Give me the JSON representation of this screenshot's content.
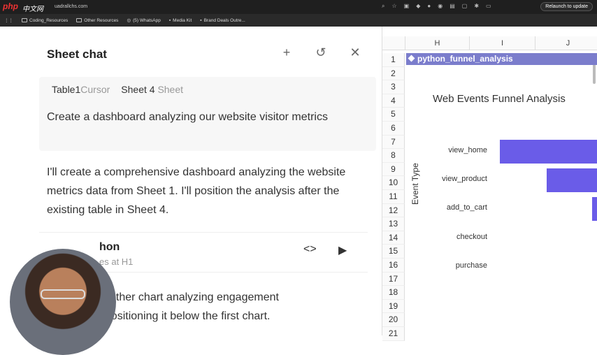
{
  "browser": {
    "logo": "php",
    "logo_sub": "中文网",
    "url": "uadrallchs.com",
    "relaunch_label": "Relaunch to update"
  },
  "bookmarks": [
    "Coding_Resources",
    "Other Resources",
    "(5) WhatsApp",
    "Media Kit",
    "Brand Deals Outre..."
  ],
  "chat": {
    "title": "Sheet chat",
    "new_icon": "plus-icon",
    "history_icon": "history-icon",
    "close_icon": "close-icon",
    "user_message": {
      "tags": [
        {
          "name": "Table1",
          "kind": "Cursor"
        },
        {
          "name": "Sheet 4",
          "kind": "Sheet"
        }
      ],
      "text": "Create a dashboard analyzing our website visitor metrics"
    },
    "reply_1": "I'll create a comprehensive dashboard analyzing the website metrics data from Sheet 1. I'll position the analysis after the existing table in Sheet 4.",
    "code_card": {
      "title": "hon",
      "subtitle": "es at H1",
      "code_icon": "code-icon",
      "run_icon": "play-icon"
    },
    "reply_2_line1": "other chart analyzing engagement",
    "reply_2_line2": ", positioning it below the first chart."
  },
  "sheet": {
    "columns": [
      "H",
      "I",
      "J"
    ],
    "rows": [
      "1",
      "2",
      "3",
      "4",
      "5",
      "6",
      "7",
      "8",
      "9",
      "10",
      "11",
      "12",
      "13",
      "14",
      "15",
      "16",
      "17",
      "18",
      "19",
      "20",
      "21"
    ],
    "chart_header": "python_funnel_analysis"
  },
  "chart_data": {
    "type": "bar",
    "title": "Web Events Funnel Analysis",
    "ylabel": "Event Type",
    "categories": [
      "view_home",
      "view_product",
      "add_to_cart",
      "checkout",
      "purchase"
    ],
    "values": [
      1.0,
      0.52,
      0.06,
      0.0,
      0.0
    ]
  }
}
